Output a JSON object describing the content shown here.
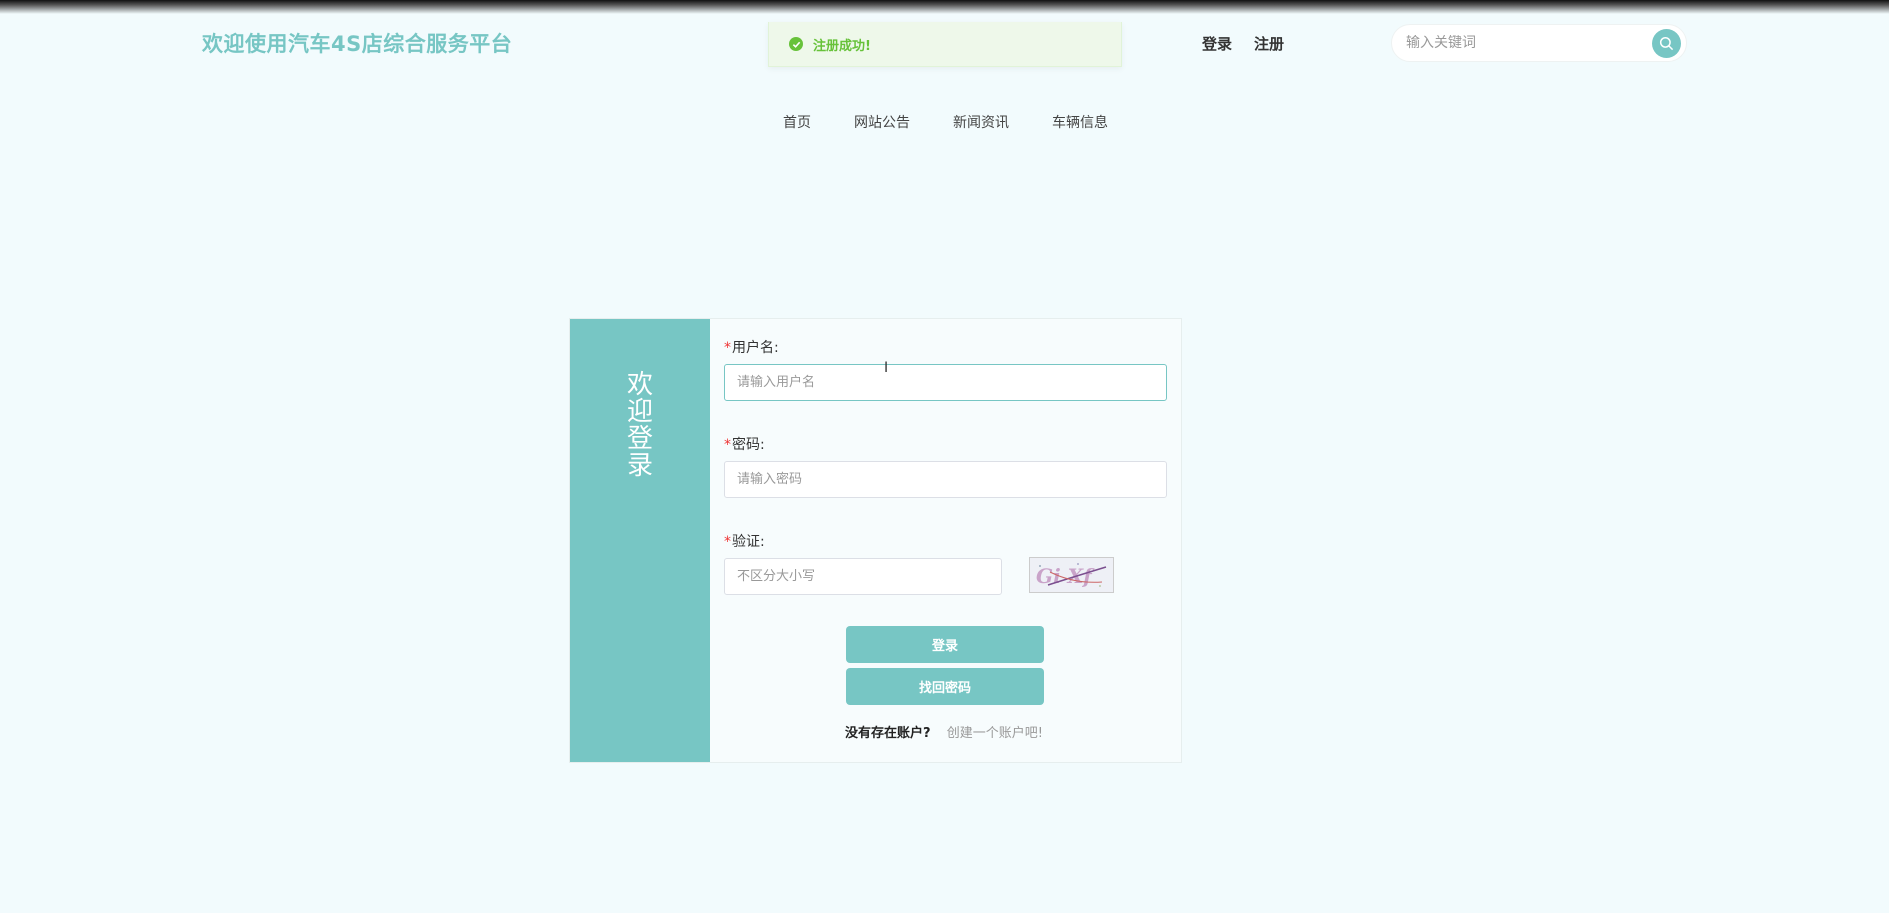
{
  "site": {
    "title": "欢迎使用汽车4S店综合服务平台"
  },
  "toast": {
    "message": "注册成功!"
  },
  "header": {
    "login_label": "登录",
    "register_label": "注册",
    "search_placeholder": "输入关键词"
  },
  "nav": {
    "items": [
      {
        "label": "首页"
      },
      {
        "label": "网站公告"
      },
      {
        "label": "新闻资讯"
      },
      {
        "label": "车辆信息"
      }
    ]
  },
  "login": {
    "side_text": "欢迎登录",
    "required_mark": "*",
    "username_label": "用户名:",
    "username_placeholder": "请输入用户名",
    "password_label": "密码:",
    "password_placeholder": "请输入密码",
    "captcha_label": "验证:",
    "captcha_placeholder": "不区分大小写",
    "captcha_text": "Gi Xf",
    "login_button": "登录",
    "forgot_button": "找回密码",
    "no_account_text": "没有存在账户?",
    "create_account_link": "创建一个账户吧!"
  },
  "colors": {
    "accent": "#77c6c4",
    "background": "#f2fbfd",
    "success": "#67c23a",
    "required": "#ee3333"
  },
  "icons": {
    "toast": "check-circle-icon",
    "search": "search-icon"
  }
}
